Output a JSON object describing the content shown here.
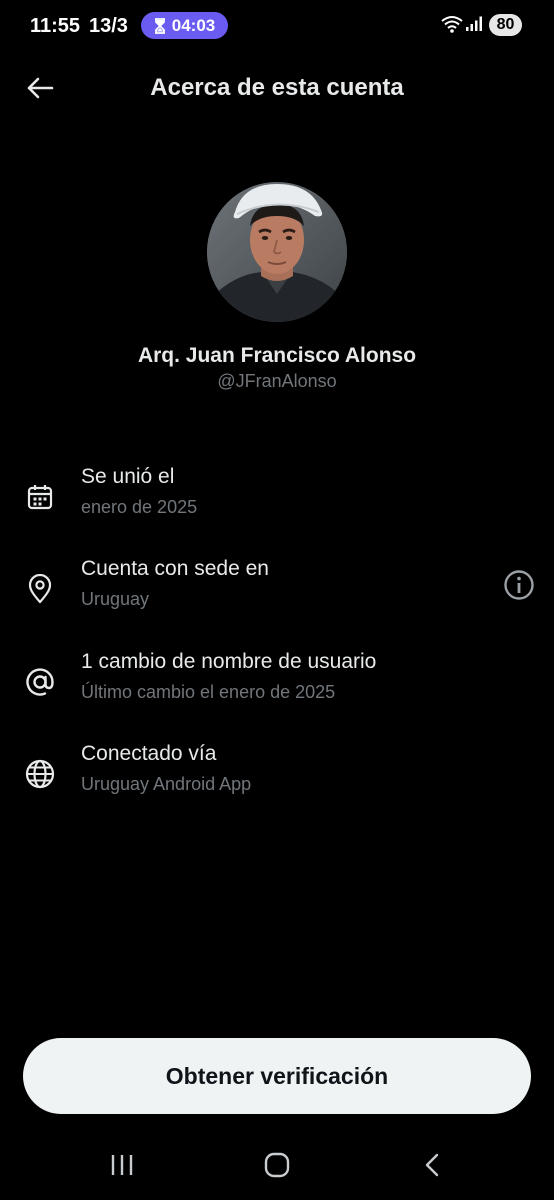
{
  "status_bar": {
    "time": "11:55",
    "date": "13/3",
    "timer": "04:03",
    "battery": "80",
    "timer_color": "#6a5cf0"
  },
  "header": {
    "title": "Acerca de esta cuenta",
    "back_icon": "arrow-left-icon"
  },
  "profile": {
    "name": "Arq. Juan Francisco Alonso",
    "handle": "@JFranAlonso"
  },
  "info": [
    {
      "icon": "calendar-icon",
      "title": "Se unió el",
      "subtitle": "enero de 2025"
    },
    {
      "icon": "location-pin-icon",
      "title": "Cuenta con sede en",
      "subtitle": "Uruguay",
      "action_icon": "info-icon"
    },
    {
      "icon": "at-sign-icon",
      "title": "1 cambio de nombre de usuario",
      "subtitle": "Último cambio el enero de 2025"
    },
    {
      "icon": "globe-icon",
      "title": "Conectado vía",
      "subtitle": "Uruguay Android App"
    }
  ],
  "cta": {
    "label": "Obtener verificación"
  },
  "nav": {
    "recents_icon": "recent-apps-icon",
    "home_icon": "home-icon",
    "back_icon": "back-chevron-icon"
  },
  "colors": {
    "background": "#000000",
    "primary_text": "#e7e9ea",
    "secondary_text": "#71767b",
    "button_bg": "#eff3f4",
    "button_text": "#0f1419"
  }
}
